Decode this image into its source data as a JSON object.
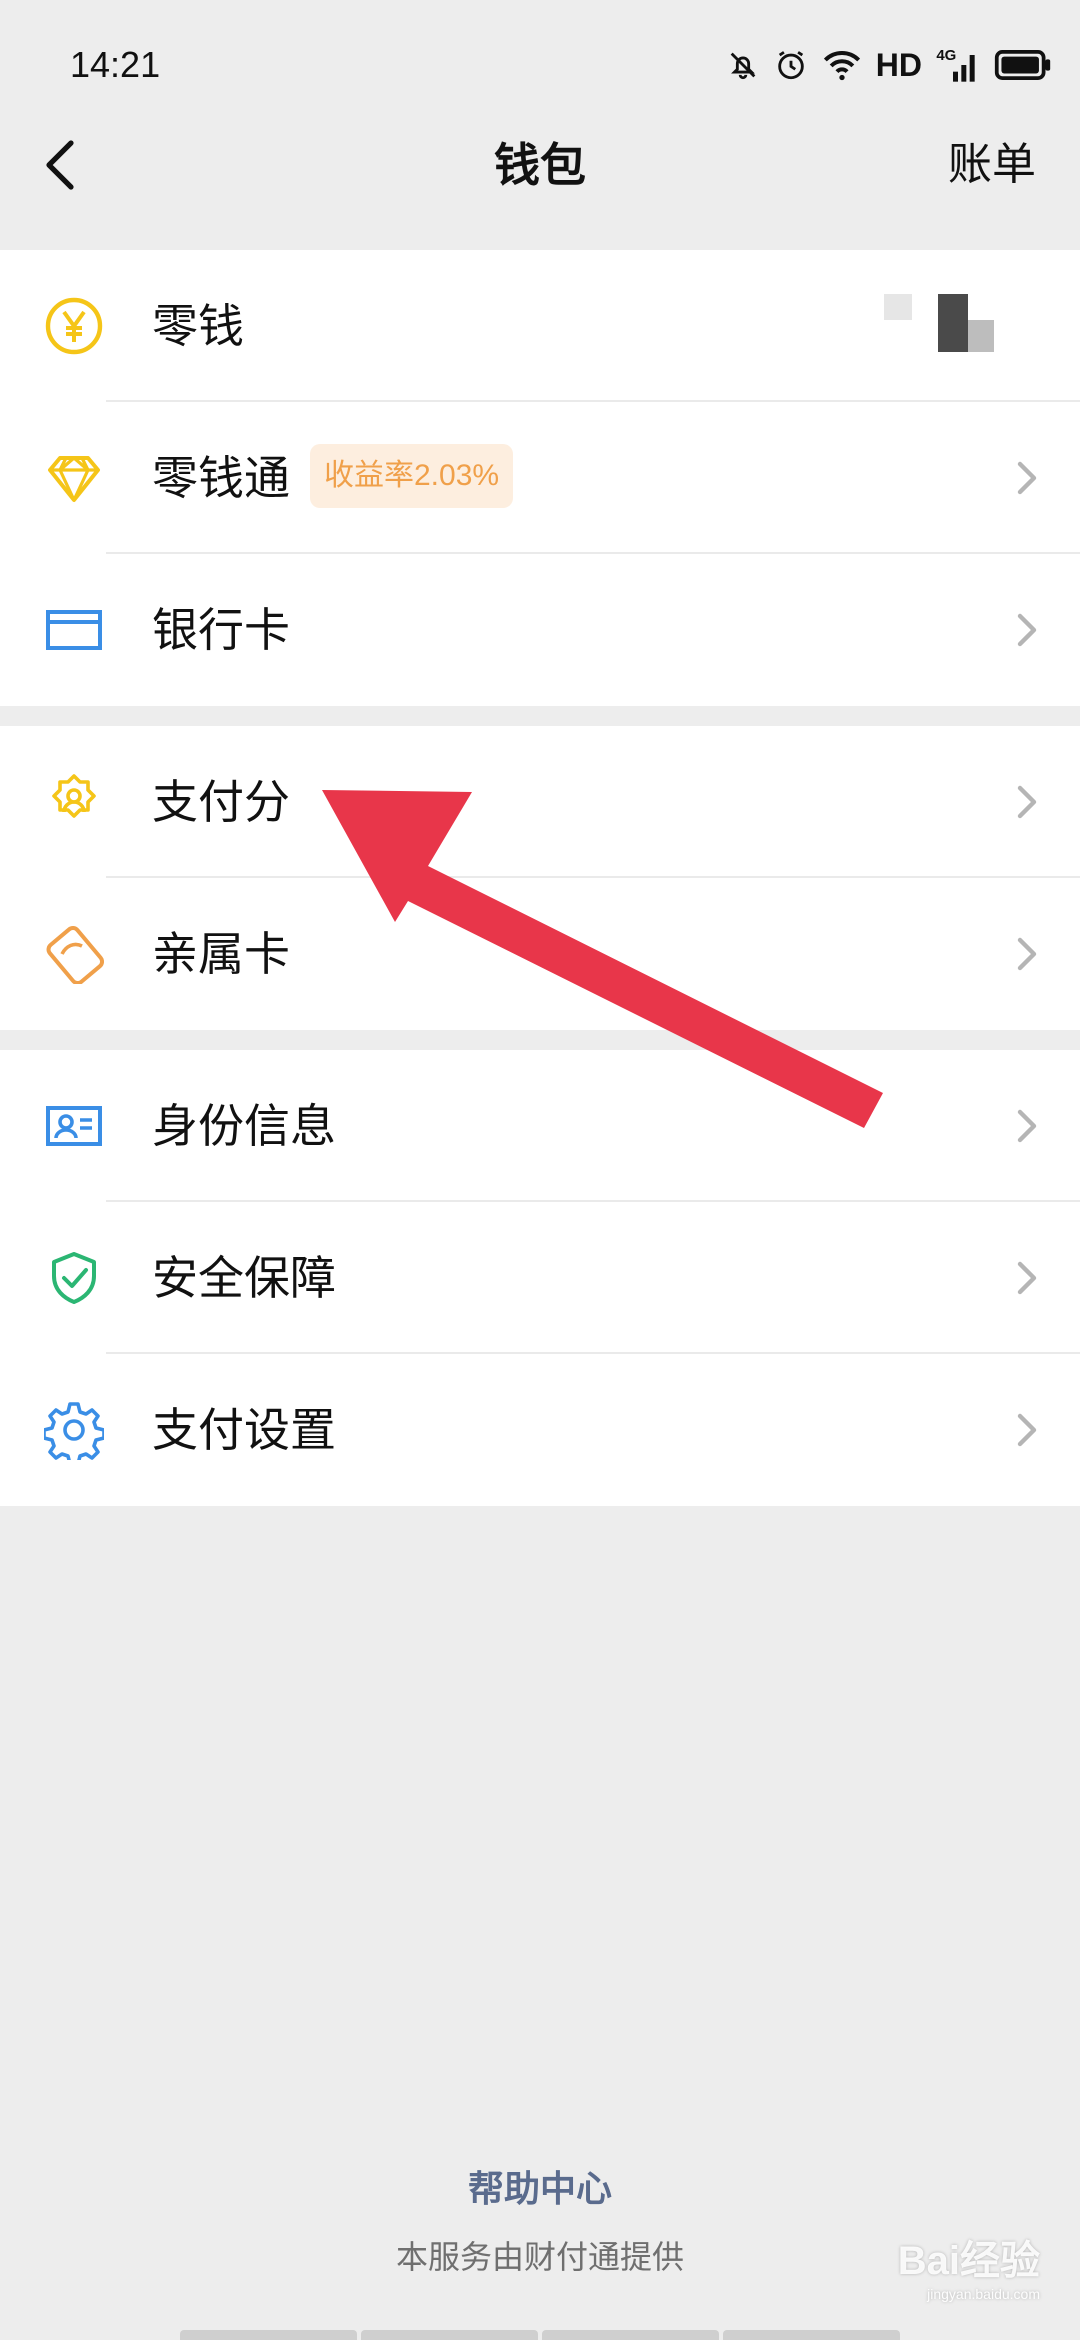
{
  "status_bar": {
    "time": "14:21",
    "hd": "HD",
    "network": "4G",
    "icons": [
      "bell-off-icon",
      "alarm-icon",
      "wifi-icon",
      "signal-icon",
      "battery-icon"
    ]
  },
  "nav": {
    "back_icon": "chevron-left-icon",
    "title": "钱包",
    "right_link": "账单"
  },
  "groups": [
    {
      "items": [
        {
          "label": "零钱",
          "icon": "yen-coin-icon",
          "color": "#f5c518",
          "value": "masked"
        },
        {
          "label": "零钱通",
          "icon": "diamond-icon",
          "color": "#f5c518",
          "badge": "收益率2.03%"
        },
        {
          "label": "银行卡",
          "icon": "card-icon",
          "color": "#3a8ee6"
        }
      ]
    },
    {
      "items": [
        {
          "label": "支付分",
          "icon": "badge-star-icon",
          "color": "#f5c518"
        },
        {
          "label": "亲属卡",
          "icon": "family-card-icon",
          "color": "#f0a04a"
        }
      ]
    },
    {
      "items": [
        {
          "label": "身份信息",
          "icon": "id-card-icon",
          "color": "#3a8ee6"
        },
        {
          "label": "安全保障",
          "icon": "shield-check-icon",
          "color": "#2bb673"
        },
        {
          "label": "支付设置",
          "icon": "gear-icon",
          "color": "#3a8ee6"
        }
      ]
    }
  ],
  "footer": {
    "help_center": "帮助中心",
    "provider_note": "本服务由财付通提供"
  },
  "watermark": {
    "brand": "Bai经验",
    "url": "jingyan.baidu.com"
  },
  "annotation": {
    "color": "#e8364a",
    "target": "支付分"
  }
}
